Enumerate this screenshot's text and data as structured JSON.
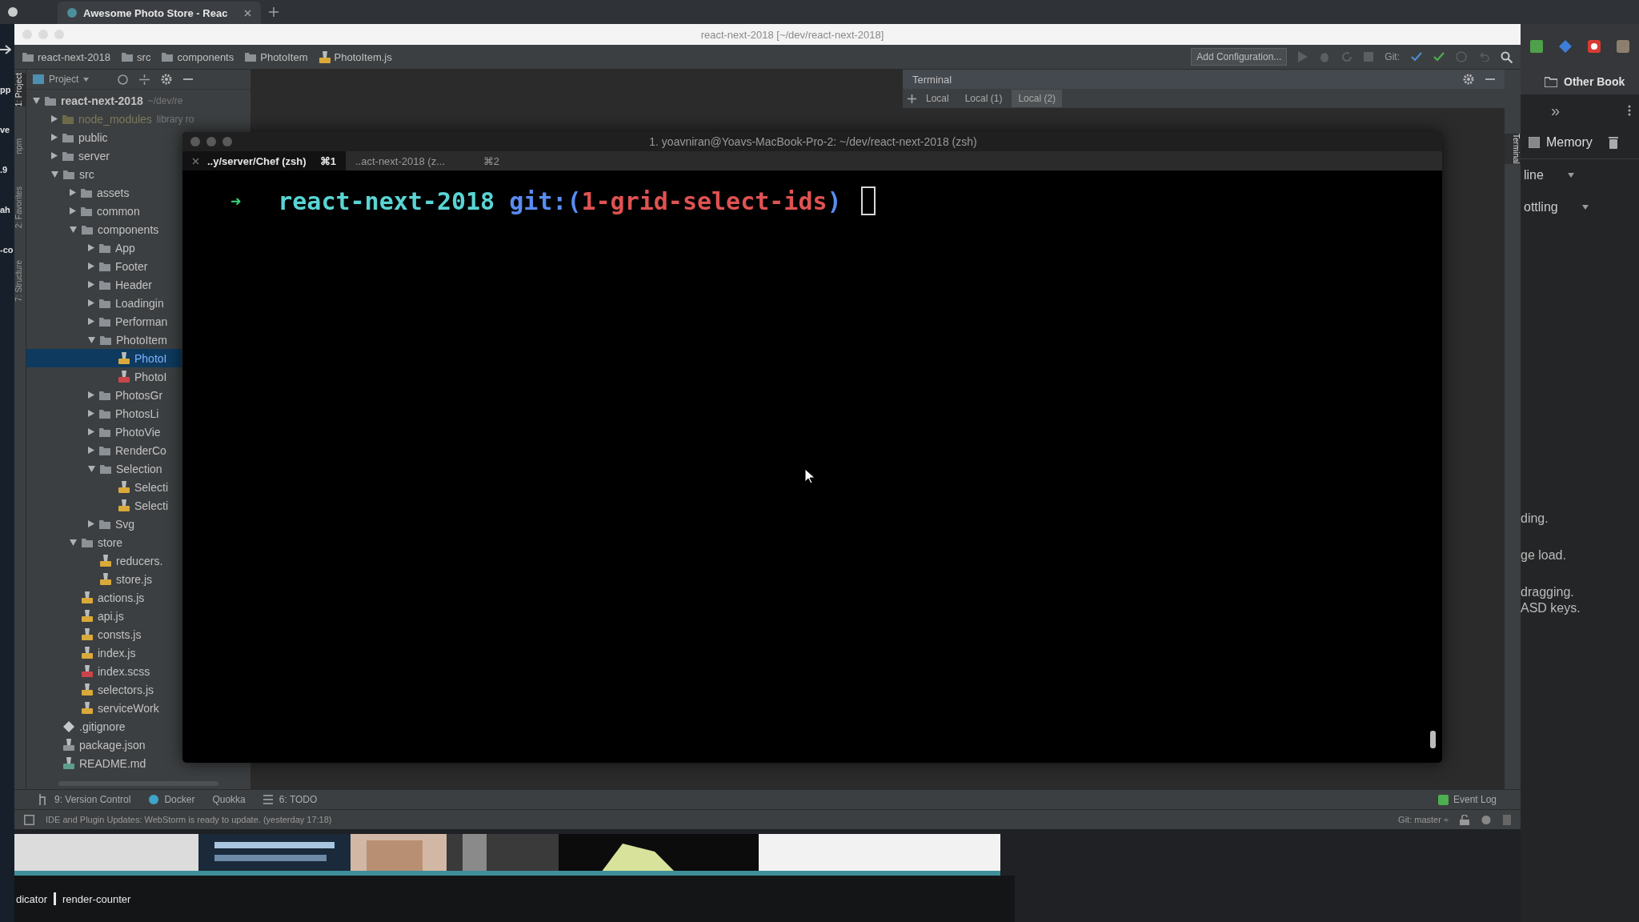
{
  "browser": {
    "tab_title": "Awesome Photo Store - Reac",
    "left_fragments": [
      "pp",
      "ve",
      ".9",
      "ah",
      "-co"
    ],
    "bookmark": "Other Book",
    "overflow": "»",
    "devtools": {
      "memory": {
        "label": "Memory",
        "checked": true
      },
      "selects": [
        "line",
        "ottling"
      ],
      "hints": [
        "ding.",
        "ge load.",
        "dragging.",
        "ASD keys."
      ]
    },
    "footer": [
      "dicator",
      "render-counter"
    ]
  },
  "ide": {
    "title": "react-next-2018 [~/dev/react-next-2018]",
    "breadcrumbs": [
      {
        "label": "react-next-2018",
        "kind": "folder"
      },
      {
        "label": "src",
        "kind": "folder"
      },
      {
        "label": "components",
        "kind": "folder"
      },
      {
        "label": "PhotoItem",
        "kind": "folder"
      },
      {
        "label": "PhotoItem.js",
        "kind": "js"
      }
    ],
    "run_config": "Add Configuration...",
    "vcs": "Git:",
    "tool_strip": [
      {
        "label": "1: Project",
        "selected": true
      },
      {
        "label": "npm",
        "selected": false
      },
      {
        "label": "2: Favorites",
        "selected": false
      },
      {
        "label": "7: Structure",
        "selected": false
      }
    ],
    "project": {
      "title": "Project",
      "tree": [
        {
          "label": "react-next-2018",
          "note": "~/dev/re",
          "kind": "folder",
          "expanded": true,
          "selected": false,
          "children": [
            {
              "label": "node_modules",
              "note": "library ro",
              "kind": "library",
              "expanded": false,
              "selected": false
            },
            {
              "label": "public",
              "kind": "folder",
              "expanded": false,
              "selected": false
            },
            {
              "label": "server",
              "kind": "folder",
              "expanded": false,
              "selected": false
            },
            {
              "label": "src",
              "kind": "folder",
              "expanded": true,
              "selected": false,
              "children": [
                {
                  "label": "assets",
                  "kind": "folder",
                  "expanded": false,
                  "selected": false
                },
                {
                  "label": "common",
                  "kind": "folder",
                  "expanded": false,
                  "selected": false
                },
                {
                  "label": "components",
                  "kind": "folder",
                  "expanded": true,
                  "selected": false,
                  "children": [
                    {
                      "label": "App",
                      "kind": "folder",
                      "expanded": false,
                      "selected": false
                    },
                    {
                      "label": "Footer",
                      "kind": "folder",
                      "expanded": false,
                      "selected": false
                    },
                    {
                      "label": "Header",
                      "kind": "folder",
                      "expanded": false,
                      "selected": false
                    },
                    {
                      "label": "Loadingin",
                      "kind": "folder",
                      "expanded": false,
                      "selected": false
                    },
                    {
                      "label": "Performan",
                      "kind": "folder",
                      "expanded": false,
                      "selected": false
                    },
                    {
                      "label": "PhotoItem",
                      "kind": "folder",
                      "expanded": true,
                      "selected": false,
                      "children": [
                        {
                          "label": "PhotoI",
                          "kind": "js",
                          "selected": true
                        },
                        {
                          "label": "PhotoI",
                          "kind": "scss",
                          "selected": false
                        }
                      ]
                    },
                    {
                      "label": "PhotosGr",
                      "kind": "folder",
                      "expanded": false,
                      "selected": false
                    },
                    {
                      "label": "PhotosLi",
                      "kind": "folder",
                      "expanded": false,
                      "selected": false
                    },
                    {
                      "label": "PhotoVie",
                      "kind": "folder",
                      "expanded": false,
                      "selected": false
                    },
                    {
                      "label": "RenderCo",
                      "kind": "folder",
                      "expanded": false,
                      "selected": false
                    },
                    {
                      "label": "Selection",
                      "kind": "folder",
                      "expanded": true,
                      "selected": false,
                      "children": [
                        {
                          "label": "Selecti",
                          "kind": "js",
                          "selected": false
                        },
                        {
                          "label": "Selecti",
                          "kind": "js",
                          "selected": false
                        }
                      ]
                    },
                    {
                      "label": "Svg",
                      "kind": "folder",
                      "expanded": false,
                      "selected": false
                    }
                  ]
                },
                {
                  "label": "store",
                  "kind": "folder",
                  "expanded": true,
                  "selected": false,
                  "children": [
                    {
                      "label": "reducers.",
                      "kind": "js",
                      "selected": false
                    },
                    {
                      "label": "store.js",
                      "kind": "js",
                      "selected": false
                    }
                  ]
                },
                {
                  "label": "actions.js",
                  "kind": "js",
                  "selected": false
                },
                {
                  "label": "api.js",
                  "kind": "js",
                  "selected": false
                },
                {
                  "label": "consts.js",
                  "kind": "js",
                  "selected": false
                },
                {
                  "label": "index.js",
                  "kind": "js",
                  "selected": false
                },
                {
                  "label": "index.scss",
                  "kind": "scss",
                  "selected": false
                },
                {
                  "label": "selectors.js",
                  "kind": "js",
                  "selected": false
                },
                {
                  "label": "serviceWork",
                  "kind": "js",
                  "selected": false
                }
              ]
            },
            {
              "label": ".gitignore",
              "kind": "git",
              "selected": false
            },
            {
              "label": "package.json",
              "kind": "json",
              "selected": false
            },
            {
              "label": "README.md",
              "kind": "md",
              "selected": false
            }
          ]
        }
      ]
    },
    "terminal_panel": {
      "title": "Terminal",
      "tabs": [
        {
          "label": "Local",
          "selected": false
        },
        {
          "label": "Local (1)",
          "selected": false
        },
        {
          "label": "Local (2)",
          "selected": true
        }
      ]
    },
    "right_strip": [
      {
        "label": "Terminal",
        "selected": true
      }
    ],
    "tool_windows": [
      {
        "label": "9: Version Control",
        "kind": "vcs"
      },
      {
        "label": "Docker",
        "kind": "docker"
      },
      {
        "label": "Quokka",
        "kind": "plain"
      },
      {
        "label": "6: TODO",
        "kind": "todo"
      }
    ],
    "event_log": "Event Log",
    "status": "IDE and Plugin Updates: WebStorm is ready to update. (yesterday 17:18)",
    "git_branch": "Git: master ÷"
  },
  "terminal": {
    "title": "1. yoavniran@Yoavs-MacBook-Pro-2: ~/dev/react-next-2018 (zsh)",
    "tabs": [
      {
        "label": "..y/server/Chef (zsh)",
        "shortcut": "⌘1",
        "selected": true
      },
      {
        "label": "..act-next-2018 (z...",
        "shortcut": "⌘2",
        "selected": false
      }
    ],
    "prompt": {
      "arrow": "➜",
      "dir": "react-next-2018",
      "git_open": "git:(",
      "branch": "1-grid-select-ids",
      "git_close": ")"
    }
  }
}
